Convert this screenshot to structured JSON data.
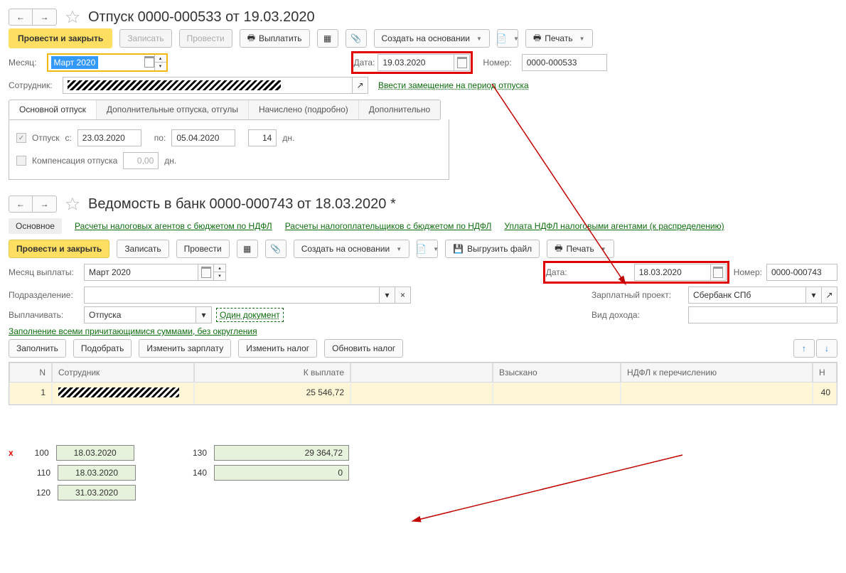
{
  "doc1": {
    "title": "Отпуск 0000-000533 от 19.03.2020",
    "toolbar": {
      "post_close": "Провести и закрыть",
      "save": "Записать",
      "post": "Провести",
      "pay": "Выплатить",
      "based_on": "Создать на основании",
      "print": "Печать"
    },
    "fields": {
      "month_label": "Месяц:",
      "month_value": "Март 2020",
      "date_label": "Дата:",
      "date_value": "19.03.2020",
      "number_label": "Номер:",
      "number_value": "0000-000533",
      "employee_label": "Сотрудник:",
      "substitution_link": "Ввести замещение на период отпуска"
    },
    "tabs": {
      "main": "Основной отпуск",
      "extra": "Дополнительные отпуска, отгулы",
      "accrued": "Начислено (подробно)",
      "more": "Дополнительно"
    },
    "body": {
      "vacation_chk": "Отпуск",
      "from_label": "с:",
      "from_value": "23.03.2020",
      "to_label": "по:",
      "to_value": "05.04.2020",
      "days_value": "14",
      "days_suffix": "дн.",
      "comp_chk": "Компенсация отпуска",
      "comp_value": "0,00",
      "comp_suffix": "дн."
    }
  },
  "doc2": {
    "title": "Ведомость в банк 0000-000743 от 18.03.2020 *",
    "nav": {
      "main": "Основное",
      "link1": "Расчеты налоговых агентов с бюджетом по НДФЛ",
      "link2": "Расчеты налогоплательщиков с бюджетом по НДФЛ",
      "link3": "Уплата НДФЛ налоговыми агентами (к распределению)"
    },
    "toolbar": {
      "post_close": "Провести и закрыть",
      "save": "Записать",
      "post": "Провести",
      "based_on": "Создать на основании",
      "export": "Выгрузить файл",
      "print": "Печать"
    },
    "fields": {
      "pay_month_label": "Месяц выплаты:",
      "pay_month_value": "Март 2020",
      "date_label": "Дата:",
      "date_value": "18.03.2020",
      "number_label": "Номер:",
      "number_value": "0000-000743",
      "dept_label": "Подразделение:",
      "project_label": "Зарплатный проект:",
      "project_value": "Сбербанк СПб",
      "pay_label": "Выплачивать:",
      "pay_value": "Отпуска",
      "one_doc": "Один документ",
      "income_label": "Вид дохода:",
      "fill_link": "Заполнение всеми причитающимися суммами, без округления"
    },
    "tb2": {
      "fill": "Заполнить",
      "pick": "Подобрать",
      "edit_salary": "Изменить зарплату",
      "edit_tax": "Изменить налог",
      "refresh_tax": "Обновить налог"
    },
    "grid": {
      "h_n": "N",
      "h_emp": "Сотрудник",
      "h_pay": "К выплате",
      "h_vz": "Взыскано",
      "h_ndfl": "НДФЛ к перечислению",
      "h_last": "Н",
      "r1_n": "1",
      "r1_pay": "25 546,72",
      "r1_last": "40"
    }
  },
  "bottom": {
    "r100_code": "100",
    "r100_val": "18.03.2020",
    "r110_code": "110",
    "r110_val": "18.03.2020",
    "r120_code": "120",
    "r120_val": "31.03.2020",
    "r130_code": "130",
    "r130_val": "29 364,72",
    "r140_code": "140",
    "r140_val": "0"
  }
}
